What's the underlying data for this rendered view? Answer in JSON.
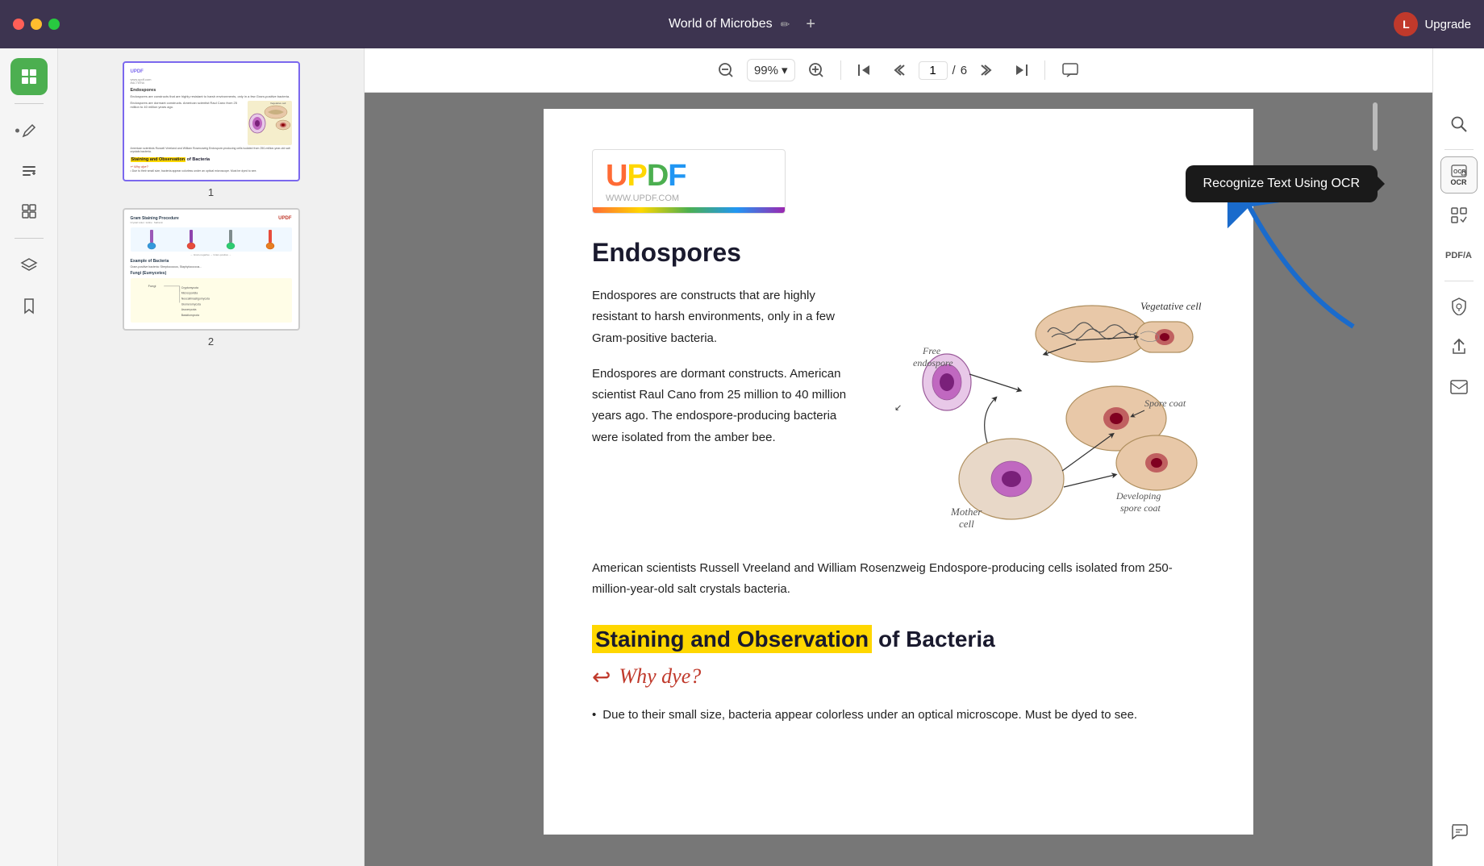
{
  "titlebar": {
    "title": "World of Microbes",
    "edit_icon": "✏",
    "add_icon": "+",
    "upgrade_label": "Upgrade",
    "avatar_letter": "L"
  },
  "window_controls": {
    "close_label": "close",
    "min_label": "minimize",
    "max_label": "maximize"
  },
  "toolbar": {
    "zoom_value": "99%",
    "page_current": "1",
    "page_total": "6",
    "zoom_out_label": "−",
    "zoom_in_label": "+",
    "search_label": "search"
  },
  "ocr_tooltip": {
    "text": "Recognize Text Using OCR"
  },
  "pdf_content": {
    "updf_url": "WWW.UPDF.COM",
    "title1": "Endospores",
    "para1": "Endospores are constructs that are highly resistant to harsh environments, only in a few Gram-positive bacteria.",
    "para2": "Endospores are dormant constructs. American scientist Raul Cano from 25 million to 40 million years ago. The endospore-producing bacteria were isolated from the amber bee.",
    "para3": "American scientists Russell Vreeland and William Rosenzweig Endospore-producing cells isolated from 250-million-year-old salt crystals bacteria.",
    "title2": "Staining and Observation",
    "title2_rest": " of Bacteria",
    "why_dye": "Why dye?",
    "bullet1": "Due to their small size, bacteria appear colorless under an optical microscope. Must be dyed to see."
  },
  "diagram": {
    "vegetative_cell": "Vegetative cell",
    "free_endospore": "Free\nendospore",
    "spore_coat": "Spore coat",
    "developing_spore_coat": "Developing\nspore coat",
    "mother_cell": "Mother\ncell"
  },
  "sidebar_icons": [
    {
      "name": "thumbnail-view",
      "icon": "▦",
      "active": true
    },
    {
      "name": "annotate",
      "icon": "✏",
      "active": false
    },
    {
      "name": "edit-text",
      "icon": "T",
      "active": false
    },
    {
      "name": "organize",
      "icon": "⊞",
      "active": false
    },
    {
      "name": "layers",
      "icon": "⬡",
      "active": false
    },
    {
      "name": "bookmark",
      "icon": "🔖",
      "active": false
    }
  ],
  "right_sidebar": [
    {
      "name": "search",
      "icon": "🔍"
    },
    {
      "name": "ocr",
      "label": "OCR"
    },
    {
      "name": "scan",
      "icon": "⊡"
    },
    {
      "name": "pdf-a",
      "label": "PDF/A"
    },
    {
      "name": "protect",
      "icon": "🔒"
    },
    {
      "name": "share",
      "icon": "↑"
    },
    {
      "name": "mail",
      "icon": "✉"
    },
    {
      "name": "chat",
      "icon": "💬"
    }
  ],
  "thumbnails": [
    {
      "label": "1"
    },
    {
      "label": "2"
    }
  ]
}
